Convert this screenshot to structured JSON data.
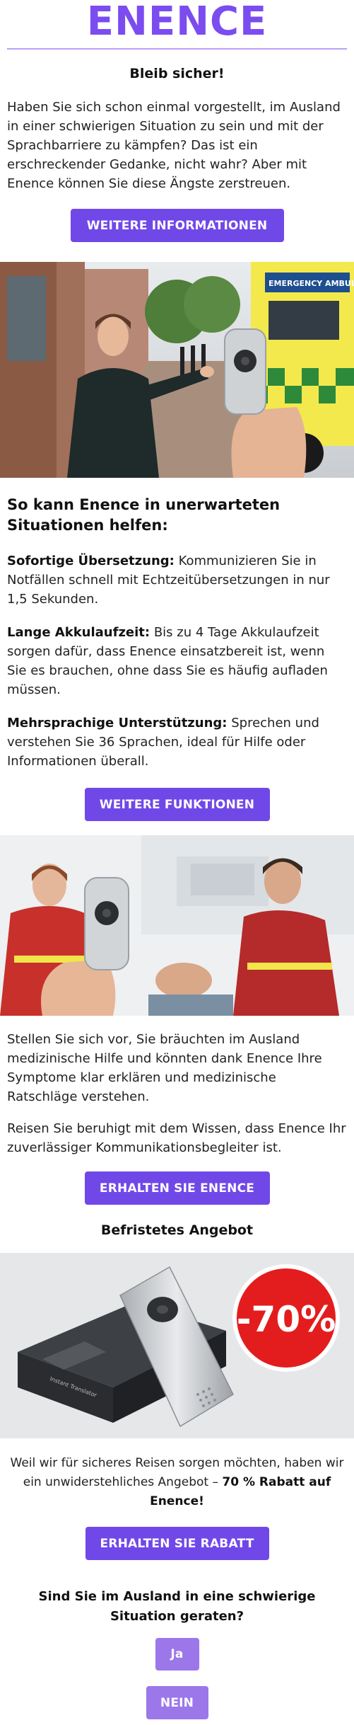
{
  "brand": {
    "logo_text": "ENENCE",
    "accent_color": "#7148e8"
  },
  "intro": {
    "heading": "Bleib sicher!",
    "text": "Haben Sie sich schon einmal vorgestellt, im Ausland in einer schwierigen Situation zu sein und mit der Sprachbarriere zu kämpfen? Das ist ein erschreckender Gedanke, nicht wahr? Aber mit Enence können Sie diese Ängste zerstreuen.",
    "button": "WEITERE INFORMATIONEN"
  },
  "hero_image": {
    "ambulance_sign": "EMERGENCY AMBULANCE",
    "alt": "Paramedic with translator device"
  },
  "features": {
    "heading": "So kann Enence in unerwarteten Situationen helfen:",
    "items": [
      {
        "title": "Sofortige Übersetzung:",
        "text": " Kommunizieren Sie in Notfällen schnell mit Echtzeitübersetzungen in nur 1,5 Sekunden."
      },
      {
        "title": "Lange Akkulaufzeit:",
        "text": " Bis zu 4 Tage Akkulaufzeit sorgen dafür, dass Enence einsatzbereit ist, wenn Sie es brauchen, ohne dass Sie es häufig aufladen müssen."
      },
      {
        "title": "Mehrsprachige Unterstützung:",
        "text": " Sprechen und verstehen Sie 36 Sprachen, ideal für Hilfe oder Informationen überall."
      }
    ],
    "button": "WEITERE FUNKTIONEN"
  },
  "medical": {
    "text1": "Stellen Sie sich vor, Sie bräuchten im Ausland medizinische Hilfe und könnten dank Enence Ihre Symptome klar erklären und medizinische Ratschläge verstehen.",
    "text2": "Reisen Sie beruhigt mit dem Wissen, dass Enence Ihr zuverlässiger Kommunikationsbegleiter ist.",
    "button": "ERHALTEN SIE ENENCE"
  },
  "offer": {
    "heading": "Befristetes Angebot",
    "badge": "-70%",
    "text_before": "Weil wir für sicheres Reisen sorgen möchten, haben wir ein unwiderstehliches Angebot – ",
    "text_bold": "70 % Rabatt auf Enence!",
    "button": "ERHALTEN SIE RABATT",
    "box_label": "Instant Translator"
  },
  "question": {
    "text": "Sind Sie im Ausland in eine schwierige Situation geraten?",
    "yes": "Ja",
    "no": "NEIN"
  }
}
